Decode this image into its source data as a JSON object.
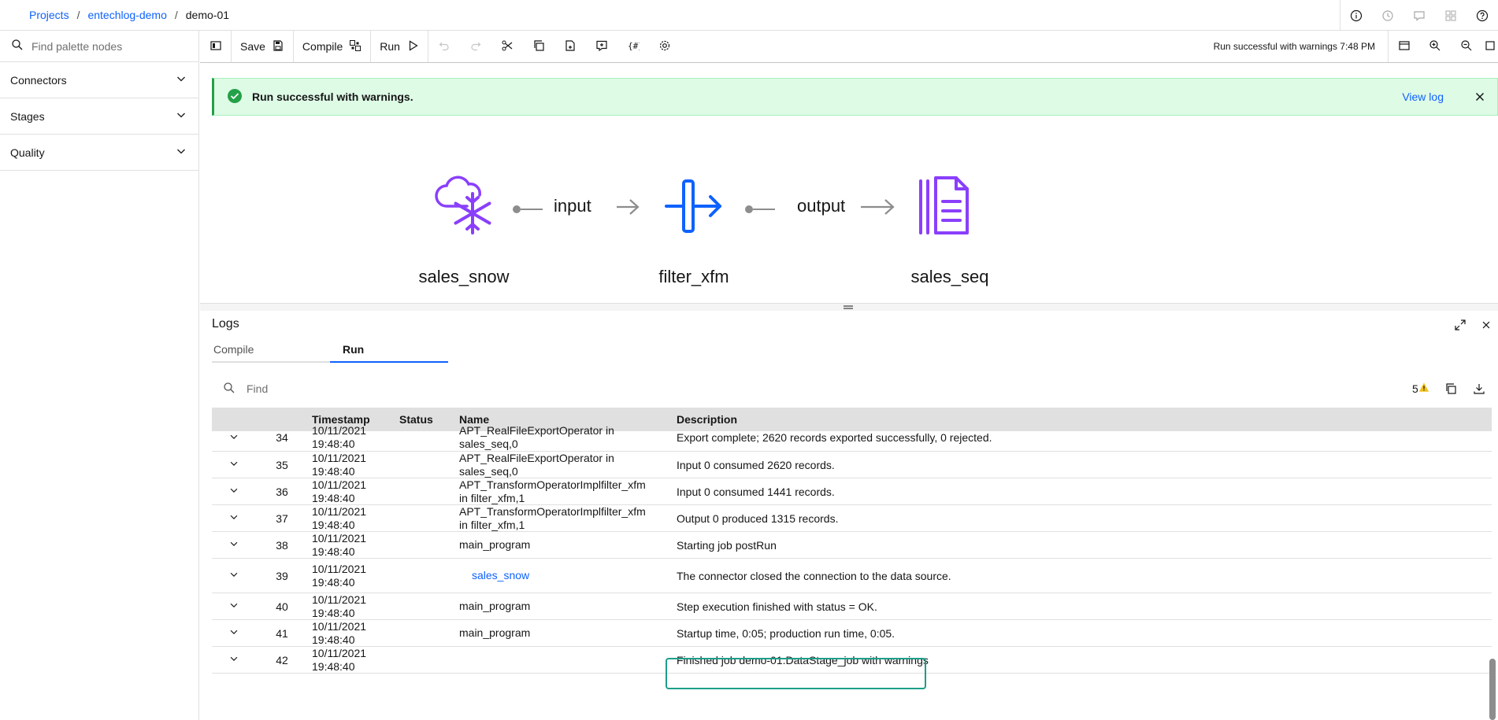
{
  "breadcrumb": {
    "projects": "Projects",
    "project": "entechlog-demo",
    "job": "demo-01"
  },
  "header_icons": [
    "info-icon",
    "history-icon",
    "comment-icon",
    "settings-apps-icon",
    "help-icon"
  ],
  "palette": {
    "search_placeholder": "Find palette nodes",
    "categories": [
      {
        "label": "Connectors"
      },
      {
        "label": "Stages"
      },
      {
        "label": "Quality"
      }
    ]
  },
  "toolbar": {
    "save_label": "Save",
    "compile_label": "Compile",
    "run_label": "Run",
    "status": "Run successful with warnings 7:48 PM"
  },
  "banner": {
    "message": "Run successful with warnings.",
    "view_log": "View log"
  },
  "flow": {
    "nodes": [
      {
        "label": "sales_snow",
        "icon": "snowflake-cloud-icon"
      },
      {
        "label": "filter_xfm",
        "icon": "transformer-icon"
      },
      {
        "label": "sales_seq",
        "icon": "sequential-file-icon"
      }
    ],
    "links": [
      {
        "label": "input"
      },
      {
        "label": "output"
      }
    ],
    "colors": {
      "purple": "#8a3ffc",
      "blue": "#0f62fe"
    }
  },
  "logs": {
    "title": "Logs",
    "tabs": [
      {
        "label": "Compile"
      },
      {
        "label": "Run"
      }
    ],
    "active_tab": "Run",
    "find_placeholder": "Find",
    "warning_count": "5",
    "columns": {
      "timestamp": "Timestamp",
      "status": "Status",
      "name": "Name",
      "description": "Description"
    },
    "rows": [
      {
        "num": "34",
        "date": "10/11/2021",
        "time": "19:48:40",
        "name1": "APT_RealFileExportOperator in",
        "name2": "sales_seq,0",
        "desc": "Export complete; 2620 records exported successfully, 0 rejected."
      },
      {
        "num": "35",
        "date": "10/11/2021",
        "time": "19:48:40",
        "name1": "APT_RealFileExportOperator in",
        "name2": "sales_seq,0",
        "desc": "Input 0 consumed 2620 records."
      },
      {
        "num": "36",
        "date": "10/11/2021",
        "time": "19:48:40",
        "name1": "APT_TransformOperatorImplfilter_xfm",
        "name2": "in filter_xfm,1",
        "desc": "Input 0 consumed 1441 records."
      },
      {
        "num": "37",
        "date": "10/11/2021",
        "time": "19:48:40",
        "name1": "APT_TransformOperatorImplfilter_xfm",
        "name2": "in filter_xfm,1",
        "desc": "Output 0 produced 1315 records."
      },
      {
        "num": "38",
        "date": "10/11/2021",
        "time": "19:48:40",
        "name1": "main_program",
        "name2": "",
        "desc": "Starting job postRun"
      },
      {
        "num": "39",
        "date": "10/11/2021",
        "time": "19:48:40",
        "name1": "sales_snow",
        "name2": "",
        "desc": "The connector closed the connection to the data source.",
        "link": true
      },
      {
        "num": "40",
        "date": "10/11/2021",
        "time": "19:48:40",
        "name1": "main_program",
        "name2": "",
        "desc": "Step execution finished with status = OK."
      },
      {
        "num": "41",
        "date": "10/11/2021",
        "time": "19:48:40",
        "name1": "main_program",
        "name2": "",
        "desc": "Startup time, 0:05; production run time, 0:05."
      },
      {
        "num": "42",
        "date": "10/11/2021",
        "time": "19:48:40",
        "name1": "",
        "name2": "",
        "desc": "Finished job demo-01.DataStage_job with warnings"
      }
    ]
  }
}
